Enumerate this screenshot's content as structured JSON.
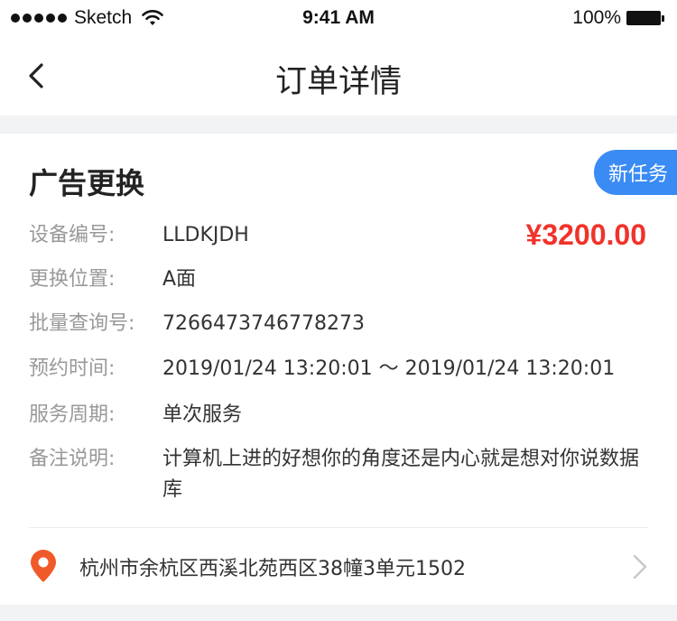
{
  "status_bar": {
    "carrier": "Sketch",
    "time": "9:41 AM",
    "battery": "100%"
  },
  "nav": {
    "title": "订单详情"
  },
  "order": {
    "title": "广告更换",
    "badge": "新任务",
    "price": "¥3200.00",
    "fields": [
      {
        "label": "设备编号:",
        "value": "LLDKJDH"
      },
      {
        "label": "更换位置:",
        "value": "A面"
      },
      {
        "label": "批量查询号:",
        "value": "7266473746778273"
      },
      {
        "label": "预约时间:",
        "value": "2019/01/24 13:20:01 ～ 2019/01/24 13:20:01"
      },
      {
        "label": "服务周期:",
        "value": "单次服务"
      },
      {
        "label": "备注说明:",
        "value": "计算机上进的好想你的角度还是内心就是想对你说数据库"
      }
    ],
    "address": "杭州市余杭区西溪北苑西区38幢3单元1502"
  },
  "colors": {
    "accent": "#3a8bf4",
    "price": "#f0332a",
    "pin": "#f05a28"
  }
}
